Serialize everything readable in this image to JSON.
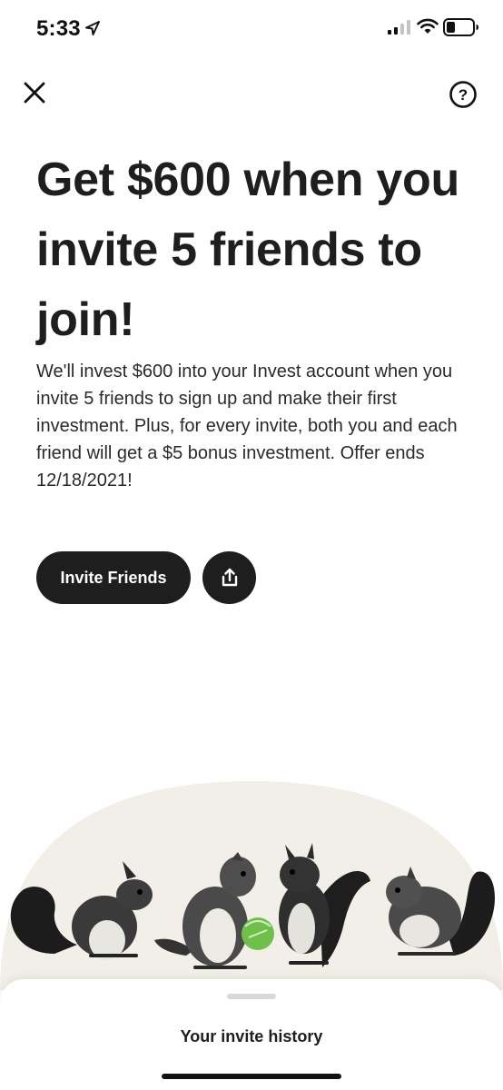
{
  "status_bar": {
    "time": "5:33",
    "icons": [
      "location-arrow-icon",
      "cellular-signal-icon",
      "wifi-icon",
      "battery-icon"
    ]
  },
  "nav": {
    "close_icon": "close-icon",
    "help_icon": "help-icon",
    "help_glyph": "?"
  },
  "content": {
    "headline": "Get $600 when you invite 5 friends to join!",
    "description": "We'll invest $600 into your Invest account when you invite 5 friends to sign up and make their first investment. Plus, for every invite, both you and each friend will get a $5 bonus investment. Offer ends 12/18/2021!",
    "invite_button_label": "Invite Friends",
    "share_icon": "share-icon"
  },
  "illustration": {
    "name": "squirrels-illustration",
    "accent_color": "#6fbf4b",
    "background_color": "#f1efe8"
  },
  "bottom_sheet": {
    "title": "Your invite history"
  },
  "colors": {
    "primary_button": "#1e1e1e",
    "text": "#1f1f1f",
    "accent_green": "#6fbf4b"
  }
}
